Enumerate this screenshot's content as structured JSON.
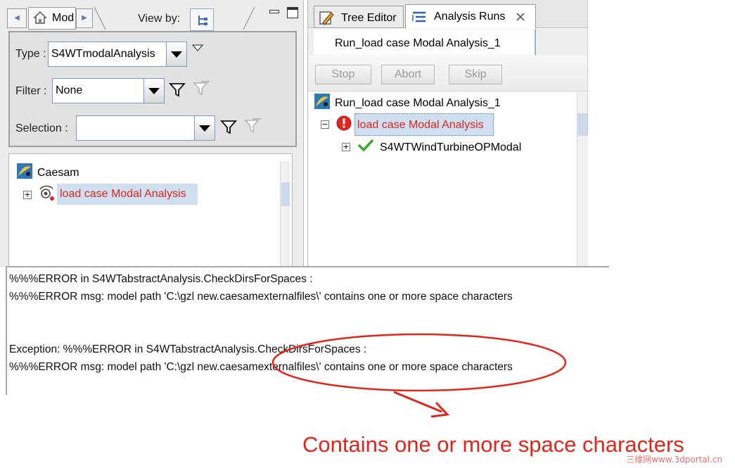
{
  "left_panel": {
    "tab_label": "Mod",
    "view_by_label": "View by:",
    "type_label": "Type :",
    "type_value": "S4WTmodalAnalysis",
    "filter_label": "Filter :",
    "filter_value": "None",
    "selection_label": "Selection :",
    "selection_value": "",
    "tree": {
      "root_label": "Caesam",
      "child_label": "load case Modal Analysis"
    }
  },
  "right_panel": {
    "tabs": [
      {
        "label": "Tree Editor"
      },
      {
        "label": "Analysis Runs"
      }
    ],
    "run_tab_label": "Run_load case Modal Analysis_1",
    "buttons": {
      "stop": "Stop",
      "abort": "Abort",
      "skip": "Skip"
    },
    "tree": {
      "root_label": "Run_load case Modal Analysis_1",
      "child_label": "load case Modal Analysis",
      "grandchild_label": "S4WTWindTurbineOPModal"
    }
  },
  "console": {
    "lines": [
      "%%%ERROR in S4WTabstractAnalysis.CheckDirsForSpaces :",
      "%%%ERROR msg: model path 'C:\\gzl new.caesamexternalfiles\\' contains one or more space characters",
      "Exception: %%%ERROR in S4WTabstractAnalysis.CheckDirsForSpaces :",
      "%%%ERROR msg: model path 'C:\\gzl new.caesamexternalfiles\\' contains one or more space characters"
    ]
  },
  "annotation": {
    "text": "Contains one or more space characters",
    "color": "#e0261c"
  },
  "watermark": "三维网www.3dportal.cn",
  "colors": {
    "error_red": "#e0261c",
    "success_green": "#3aa832",
    "selection_bg": "#cfdff2"
  },
  "icons": [
    "home-icon",
    "tree-view-icon",
    "minimize-icon",
    "maximize-icon",
    "filter-icon",
    "filter-disabled-icon",
    "caesam-icon",
    "modal-analysis-icon",
    "tree-editor-icon",
    "analysis-runs-icon",
    "close-icon",
    "run-icon",
    "error-icon",
    "check-icon"
  ]
}
